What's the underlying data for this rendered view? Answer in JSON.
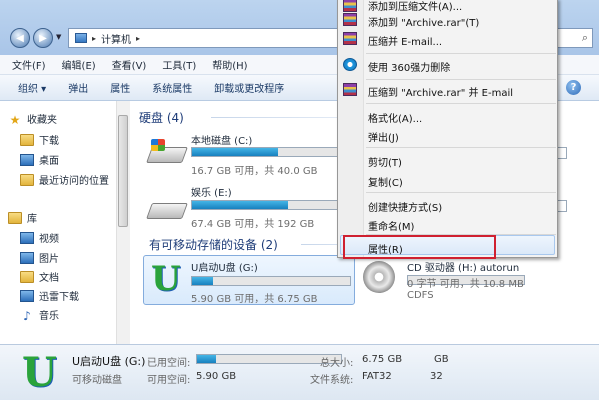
{
  "window": {
    "address": {
      "segment": "计算机"
    }
  },
  "menubar": [
    {
      "id": "file",
      "label": "文件(F)"
    },
    {
      "id": "edit",
      "label": "编辑(E)"
    },
    {
      "id": "view",
      "label": "查看(V)"
    },
    {
      "id": "tools",
      "label": "工具(T)"
    },
    {
      "id": "help",
      "label": "帮助(H)"
    }
  ],
  "commandbar": [
    {
      "id": "organize",
      "label": "组织 ▾"
    },
    {
      "id": "eject",
      "label": "弹出"
    },
    {
      "id": "properties",
      "label": "属性"
    },
    {
      "id": "system-properties",
      "label": "系统属性"
    },
    {
      "id": "uninstall",
      "label": "卸载或更改程序"
    }
  ],
  "navpane": {
    "favorites": {
      "title": "收藏夹",
      "items": [
        "下载",
        "桌面",
        "最近访问的位置"
      ]
    },
    "libraries": {
      "title": "库",
      "items": [
        "视频",
        "图片",
        "文档",
        "迅雷下载",
        "音乐"
      ]
    }
  },
  "content": {
    "hdd_group": {
      "title": "硬盘 (4)"
    },
    "removable_group": {
      "title": "有可移动存储的设备 (2)"
    },
    "drives": {
      "c": {
        "name": "本地磁盘 (C:)",
        "free": "16.7 GB 可用，共 40.0 GB",
        "used_fraction": 0.58
      },
      "e": {
        "name": "娱乐 (E:)",
        "free": "67.4 GB 可用，共 192 GB",
        "used_fraction": 0.65
      },
      "g": {
        "name": "U启动U盘 (G:)",
        "free": "5.90 GB 可用，共 6.75 GB",
        "used_fraction": 0.13
      },
      "h": {
        "name": "CD 驱动器 (H:) autorun",
        "free": "0 字节 可用，共 10.8 MB",
        "fs": "CDFS"
      }
    }
  },
  "statusbar": {
    "name": "U启动U盘 (G:)",
    "type": "可移动磁盘",
    "used_label": "已用空间:",
    "used_fraction": 0.13,
    "free_label": "可用空间:",
    "free_value": "5.90 GB",
    "total_label": "总大小:",
    "total_value": "6.75 GB",
    "fs_label": "文件系统:",
    "fs_value": "FAT32",
    "right_top": "GB",
    "right_bottom": "32"
  },
  "contextmenu": {
    "items": [
      {
        "id": "add-archive",
        "label": "添加到压缩文件(A)...",
        "icon": "winrar-icon"
      },
      {
        "id": "add-archive-rar",
        "label": "添加到 \"Archive.rar\"(T)",
        "icon": "winrar-icon"
      },
      {
        "id": "compress-email",
        "label": "压缩并 E-mail...",
        "icon": "winrar-icon"
      },
      {
        "id": "delete-360",
        "label": "使用 360强力删除",
        "icon": "360-icon"
      },
      {
        "id": "compress-rar-email",
        "label": "压缩到 \"Archive.rar\" 并 E-mail",
        "icon": "winrar-icon"
      },
      {
        "id": "format",
        "label": "格式化(A)..."
      },
      {
        "id": "eject",
        "label": "弹出(J)"
      },
      {
        "id": "cut",
        "label": "剪切(T)"
      },
      {
        "id": "copy",
        "label": "复制(C)"
      },
      {
        "id": "create-shortcut",
        "label": "创建快捷方式(S)"
      },
      {
        "id": "rename",
        "label": "重命名(M)"
      },
      {
        "id": "properties",
        "label": "属性(R)"
      }
    ]
  }
}
